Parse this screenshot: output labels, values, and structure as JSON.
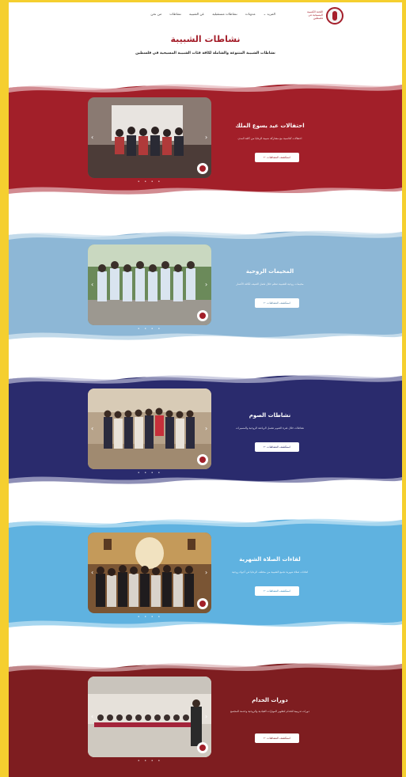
{
  "site": {
    "logo_text": "اللجنة الكنسية المسيحية في فلسطين"
  },
  "nav": {
    "items": [
      "من نحن",
      "نشاطات",
      "عن الشبيبة",
      "نشاطات مستقبلية",
      "مدونات",
      "المزيد ⌄"
    ]
  },
  "hero": {
    "title": "نشاطات الشبيبة",
    "subtitle": "نشاطات الشبيبة المتنوعة والشاملة لكافة فئات الشبيبة المسيحية في فلسطين"
  },
  "sections": [
    {
      "title": "احتفالات عيد يسوع الملك",
      "desc": "احتفالات كنائسية مع مشاركة شبيبة الرعايا من كافة المدن",
      "button": "استكشف النشاطات ←",
      "bg": "#a21f29",
      "accent": "#a21f29"
    },
    {
      "title": "المخيمات الروحية",
      "desc": "مخيمات روحية للشبيبة تنظم خلال فصل الصيف لكافة الأعمار",
      "button": "استكشف النشاطات ←",
      "bg": "#8db7d6",
      "accent": "#8db7d6"
    },
    {
      "title": "نشاطات الصوم",
      "desc": "نشاطات خلال فترة الصوم تشمل الرياضة الروحية والمسيرات",
      "button": "استكشف النشاطات ←",
      "bg": "#2a2b6d",
      "accent": "#2a2b6d"
    },
    {
      "title": "لقاءات الصلاة الشهرية",
      "desc": "لقاءات صلاة شهرية تجمع الشبيبة من مختلف الرعايا في أجواء روحية",
      "button": "استكشف النشاطات ←",
      "bg": "#5fb2e0",
      "accent": "#5fb2e0"
    },
    {
      "title": "دورات الخدام",
      "desc": "دورات تدريبية للخدام لتطوير المهارات القيادية والروحية وخدمة المجتمع",
      "button": "استكشف النشاطات ←",
      "bg": "#7e1d20",
      "accent": "#7e1d20"
    }
  ]
}
